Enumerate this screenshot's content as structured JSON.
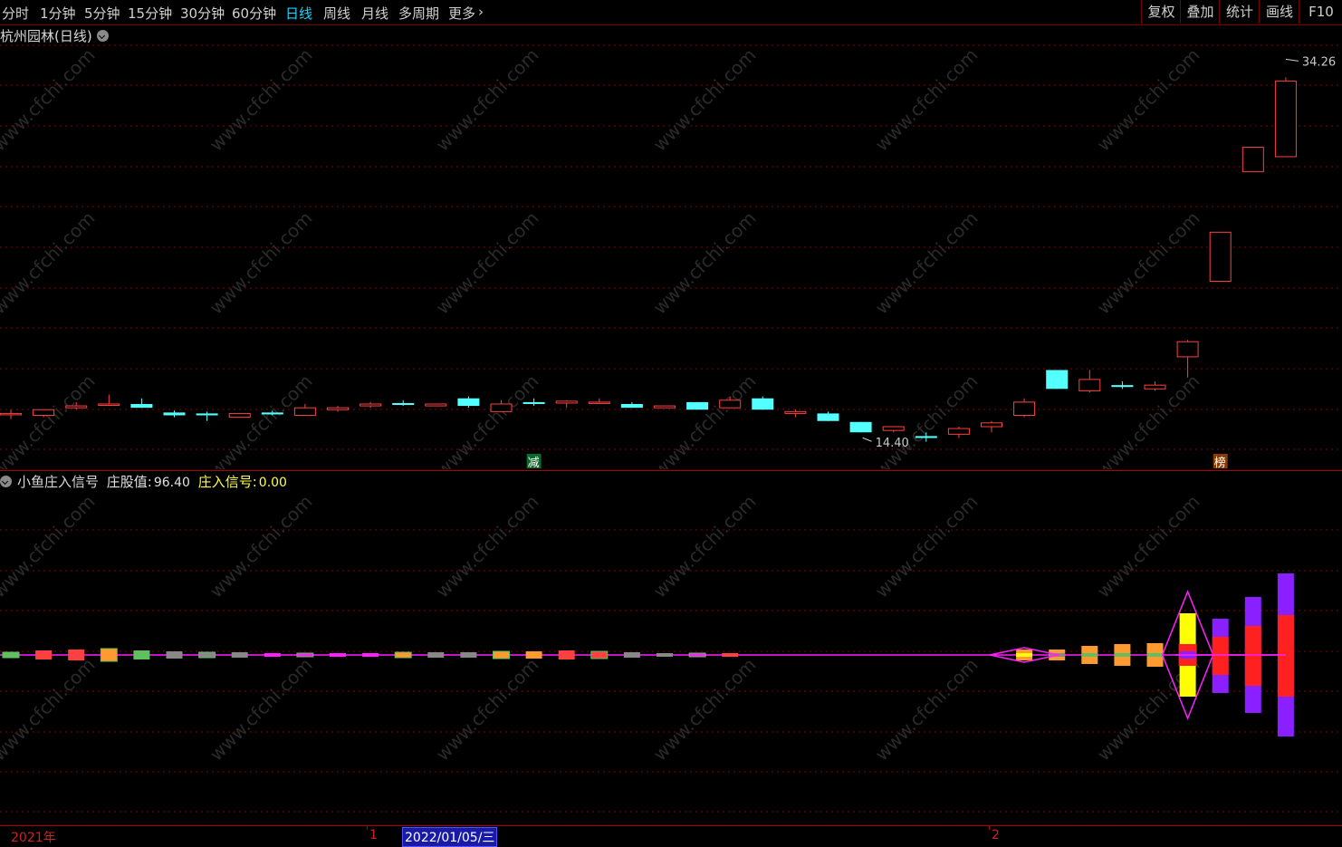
{
  "toolbar": {
    "periods": [
      "分时",
      "1分钟",
      "5分钟",
      "15分钟",
      "30分钟",
      "60分钟",
      "日线",
      "周线",
      "月线",
      "多周期",
      "更多"
    ],
    "active_period": "日线",
    "more_arrow_icon": "chevron-right-icon",
    "right_buttons": [
      "复权",
      "叠加",
      "统计",
      "画线",
      "F10"
    ]
  },
  "main": {
    "stock_title": "杭州园林(日线)",
    "high_label": "34.26",
    "low_label": "14.40",
    "badge_reduce": "减",
    "badge_rank": "榜"
  },
  "indicator": {
    "name": "小鱼庄入信号",
    "field1_label": "庄股值:",
    "field1_value": "96.40",
    "field2_label": "庄入信号:",
    "field2_value": "0.00"
  },
  "timeaxis": {
    "year": "2021年",
    "month1": "1",
    "cursor_date": "2022/01/05/三",
    "month2": "2"
  },
  "colors": {
    "up": "#ff4040",
    "down": "#54ffff",
    "grid": "#8a0000",
    "pink": "#ff20ff",
    "purple": "#8a20ff",
    "yellow": "#ffff00",
    "orange": "#ff9a30",
    "signal_label": "#ffff40"
  },
  "chart_data": {
    "type": "candlestick",
    "title": "杭州园林(日线)",
    "marked_high": 34.26,
    "marked_low": 14.4,
    "candles": [
      {
        "o": 15.4,
        "h": 15.6,
        "l": 15.1,
        "c": 15.4,
        "dir": "flat"
      },
      {
        "o": 15.3,
        "h": 15.6,
        "l": 15.2,
        "c": 15.6,
        "dir": "up"
      },
      {
        "o": 15.7,
        "h": 16.0,
        "l": 15.6,
        "c": 15.8,
        "dir": "up"
      },
      {
        "o": 15.9,
        "h": 16.4,
        "l": 15.8,
        "c": 15.9,
        "dir": "flat"
      },
      {
        "o": 15.9,
        "h": 16.2,
        "l": 15.7,
        "c": 15.7,
        "dir": "down"
      },
      {
        "o": 15.45,
        "h": 15.55,
        "l": 15.2,
        "c": 15.3,
        "dir": "down"
      },
      {
        "o": 15.4,
        "h": 15.5,
        "l": 15.0,
        "c": 15.3,
        "dir": "down"
      },
      {
        "o": 15.2,
        "h": 15.4,
        "l": 15.2,
        "c": 15.4,
        "dir": "up"
      },
      {
        "o": 15.45,
        "h": 15.55,
        "l": 15.3,
        "c": 15.35,
        "dir": "down"
      },
      {
        "o": 15.3,
        "h": 15.9,
        "l": 15.3,
        "c": 15.7,
        "dir": "up"
      },
      {
        "o": 15.6,
        "h": 15.8,
        "l": 15.5,
        "c": 15.7,
        "dir": "up"
      },
      {
        "o": 15.8,
        "h": 16.0,
        "l": 15.7,
        "c": 15.9,
        "dir": "up"
      },
      {
        "o": 15.95,
        "h": 16.1,
        "l": 15.8,
        "c": 15.85,
        "dir": "down"
      },
      {
        "o": 15.8,
        "h": 15.9,
        "l": 15.8,
        "c": 15.9,
        "dir": "up"
      },
      {
        "o": 16.2,
        "h": 16.3,
        "l": 15.7,
        "c": 15.8,
        "dir": "down"
      },
      {
        "o": 15.5,
        "h": 16.1,
        "l": 15.5,
        "c": 15.9,
        "dir": "up"
      },
      {
        "o": 16.0,
        "h": 16.2,
        "l": 15.8,
        "c": 15.9,
        "dir": "down"
      },
      {
        "o": 15.95,
        "h": 16.1,
        "l": 15.7,
        "c": 16.05,
        "dir": "up"
      },
      {
        "o": 16.0,
        "h": 16.2,
        "l": 15.9,
        "c": 16.0,
        "dir": "flat"
      },
      {
        "o": 15.9,
        "h": 16.0,
        "l": 15.7,
        "c": 15.7,
        "dir": "down"
      },
      {
        "o": 15.7,
        "h": 15.8,
        "l": 15.7,
        "c": 15.8,
        "dir": "up"
      },
      {
        "o": 16.0,
        "h": 16.0,
        "l": 15.6,
        "c": 15.6,
        "dir": "down"
      },
      {
        "o": 15.7,
        "h": 16.3,
        "l": 15.7,
        "c": 16.1,
        "dir": "up"
      },
      {
        "o": 16.2,
        "h": 16.3,
        "l": 15.6,
        "c": 15.6,
        "dir": "down"
      },
      {
        "o": 15.5,
        "h": 15.6,
        "l": 15.2,
        "c": 15.4,
        "dir": "up"
      },
      {
        "o": 15.4,
        "h": 15.5,
        "l": 15.0,
        "c": 15.0,
        "dir": "down"
      },
      {
        "o": 14.95,
        "h": 14.95,
        "l": 14.4,
        "c": 14.4,
        "dir": "down"
      },
      {
        "o": 14.5,
        "h": 14.7,
        "l": 14.4,
        "c": 14.7,
        "dir": "up"
      },
      {
        "o": 14.2,
        "h": 14.4,
        "l": 13.9,
        "c": 14.1,
        "dir": "down"
      },
      {
        "o": 14.3,
        "h": 14.7,
        "l": 14.1,
        "c": 14.6,
        "dir": "up"
      },
      {
        "o": 14.7,
        "h": 15.0,
        "l": 14.4,
        "c": 14.9,
        "dir": "up"
      },
      {
        "o": 15.3,
        "h": 16.2,
        "l": 15.2,
        "c": 16.0,
        "dir": "up"
      },
      {
        "o": 17.7,
        "h": 17.7,
        "l": 16.7,
        "c": 16.7,
        "dir": "down"
      },
      {
        "o": 16.6,
        "h": 17.7,
        "l": 16.5,
        "c": 17.2,
        "dir": "up"
      },
      {
        "o": 16.8,
        "h": 17.1,
        "l": 16.7,
        "c": 16.9,
        "dir": "down"
      },
      {
        "o": 16.7,
        "h": 17.1,
        "l": 16.6,
        "c": 16.9,
        "dir": "up"
      },
      {
        "o": 19.2,
        "h": 19.3,
        "l": 17.3,
        "c": 18.4,
        "dir": "up"
      },
      {
        "o": 22.4,
        "h": 22.8,
        "l": 22.8,
        "c": 25.0,
        "dir": "up"
      },
      {
        "o": 28.2,
        "h": 28.6,
        "l": 28.5,
        "c": 29.5,
        "dir": "up"
      },
      {
        "o": 29.0,
        "h": 33.2,
        "l": 29.0,
        "c": 33.0,
        "dir": "up"
      }
    ],
    "indicator_series": {
      "name": "小鱼庄入信号",
      "values_zhuanggu": [
        96.4
      ],
      "values_signal": [
        0.0
      ]
    }
  }
}
